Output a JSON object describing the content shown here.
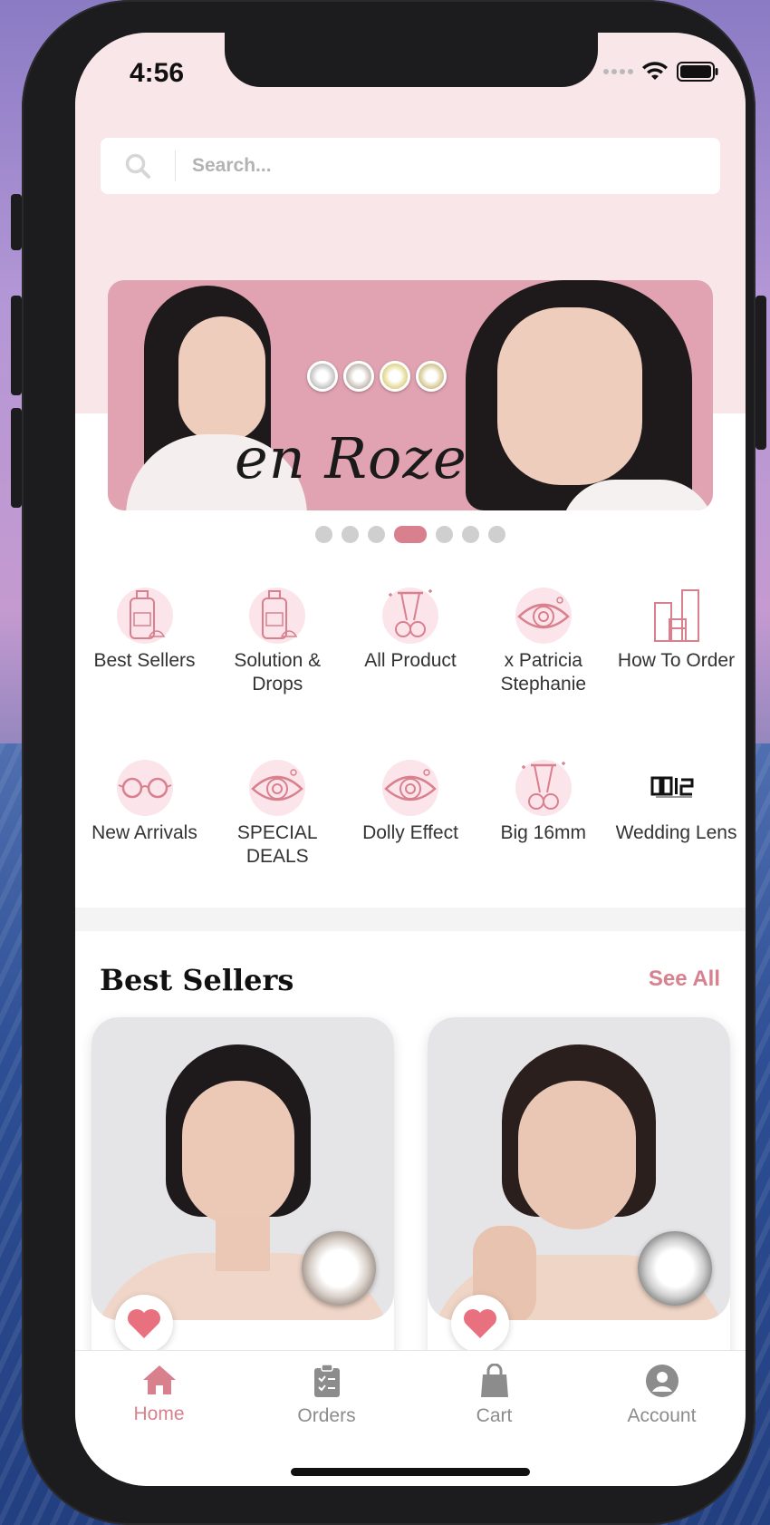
{
  "status_bar": {
    "time": "4:56"
  },
  "search": {
    "placeholder": "Search..."
  },
  "banner": {
    "brand_text": "en Roze",
    "page_count": 7,
    "active_page": 4
  },
  "categories": [
    {
      "label": "Best Sellers",
      "icon": "lotion-bottle-icon"
    },
    {
      "label": "Solution & Drops",
      "icon": "lotion-bottle-icon"
    },
    {
      "label": "All Product",
      "icon": "eyelash-curler-icon"
    },
    {
      "label": "x Patricia Stephanie",
      "icon": "eye-lens-icon"
    },
    {
      "label": "How To Order",
      "icon": "boxes-icon"
    },
    {
      "label": "New Arrivals",
      "icon": "glasses-icon"
    },
    {
      "label": "SPECIAL DEALS",
      "icon": "eye-lens-icon"
    },
    {
      "label": "Dolly Effect",
      "icon": "eye-lens-icon"
    },
    {
      "label": "Big 16mm",
      "icon": "eyelash-curler-icon"
    },
    {
      "label": "Wedding Lens",
      "icon": "qris-logo-icon"
    }
  ],
  "best_sellers": {
    "title": "Best Sellers",
    "see_all": "See All"
  },
  "tabbar": {
    "home": "Home",
    "orders": "Orders",
    "cart": "Cart",
    "account": "Account"
  },
  "colors": {
    "accent": "#d9808f",
    "pink_bg": "#f8e6e8"
  }
}
